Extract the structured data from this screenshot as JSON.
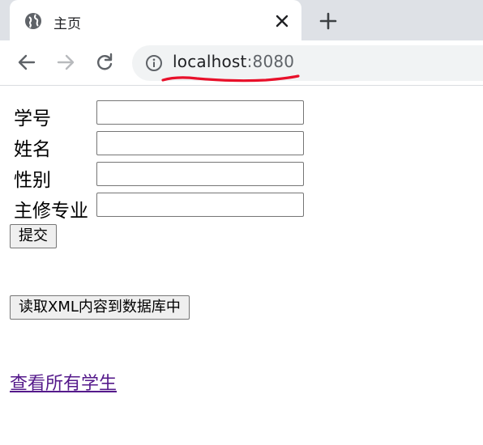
{
  "browser": {
    "tab_title": "主页",
    "url_host": "localhost",
    "url_port": ":8080",
    "annotation_color": "#e8102a"
  },
  "form": {
    "fields": [
      {
        "label": "学号",
        "value": ""
      },
      {
        "label": "姓名",
        "value": ""
      },
      {
        "label": "性别",
        "value": ""
      },
      {
        "label": "主修专业",
        "value": ""
      }
    ],
    "submit_label": "提交"
  },
  "read_xml_button": "读取XML内容到数据库中",
  "view_all_link": "查看所有学生"
}
